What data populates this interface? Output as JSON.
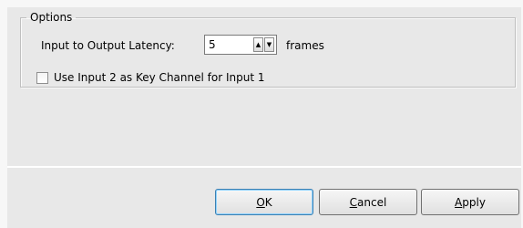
{
  "options": {
    "legend": "Options",
    "latency_label": "Input to Output Latency:",
    "latency_value": "5",
    "latency_unit": "frames",
    "key_channel_label": "Use Input 2 as Key Channel for Input 1",
    "key_channel_checked": false
  },
  "buttons": {
    "ok": {
      "accel": "O",
      "rest": "K"
    },
    "cancel": {
      "accel": "C",
      "rest": "ancel"
    },
    "apply": {
      "accel": "A",
      "rest": "pply"
    }
  },
  "icons": {
    "spin_up": "up-arrow-icon",
    "spin_down": "down-arrow-icon"
  }
}
